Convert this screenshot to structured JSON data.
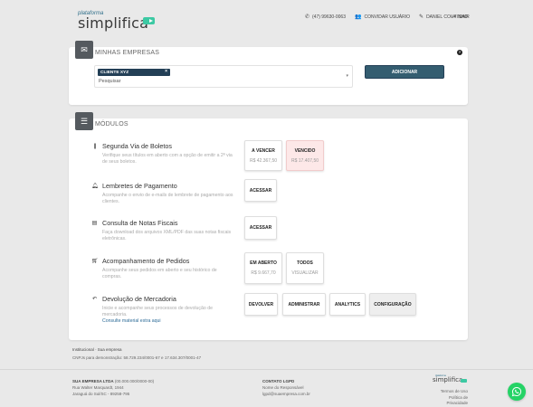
{
  "brand": {
    "small": "plataforma",
    "name": "simplifica"
  },
  "topnav": {
    "phone": "(47) 99630-0063",
    "invite": "CONVIDAR USUÁRIO",
    "user": "DANIEL COUTINHO",
    "exit": "SAIR"
  },
  "empresas": {
    "title": "MINHAS EMPRESAS",
    "tag": "CLIENTE XYZ",
    "search_placeholder": "Pesquisar",
    "add_label": "ADICIONAR"
  },
  "modulos": {
    "title": "MÓDULOS",
    "items": [
      {
        "icon": "barcode-icon",
        "title": "Segunda Via de Boletos",
        "desc": "Verifique seus títulos em aberto com a opção de emitir a 2ª via de seus boletos.",
        "tiles": [
          {
            "label": "A VENCER",
            "sub": "R$ 42.367,50"
          },
          {
            "label": "VENCIDO",
            "sub": "R$ 17.407,50"
          }
        ]
      },
      {
        "icon": "bell-icon",
        "title": "Lembretes de Pagamento",
        "desc": "Acompanhe o envio de e-mails de lembrete de pagamento aos clientes.",
        "tiles": [
          {
            "label": "ACESSAR"
          }
        ]
      },
      {
        "icon": "document-icon",
        "title": "Consulta de Notas Fiscais",
        "desc": "Faça download dos arquivos XML/PDF das suas notas fiscais eletrônicas.",
        "tiles": [
          {
            "label": "ACESSAR"
          }
        ]
      },
      {
        "icon": "cart-icon",
        "title": "Acompanhamento de Pedidos",
        "desc": "Acompanhe seus pedidos em aberto e seu histórico de compras.",
        "tiles": [
          {
            "label": "EM ABERTO",
            "sub": "R$ 9.667,70"
          },
          {
            "label": "TODOS",
            "sub": "VISUALIZAR"
          }
        ]
      },
      {
        "icon": "return-icon",
        "title": "Devolução de Mercadoria",
        "desc": "Inicie e acompanhe seus processos de devolução de mercadoria.",
        "link": "Consulte material extra aqui",
        "tiles": [
          {
            "label": "DEVOLVER"
          },
          {
            "label": "ADMINISTRAR"
          },
          {
            "label": "ANALYTICS"
          },
          {
            "label": "CONFIGURAÇÃO"
          }
        ]
      }
    ]
  },
  "footer": {
    "inst_a": "Institucional",
    "inst_sep": " - ",
    "inst_b": "Sua empresa",
    "cnpj": "CNPJs para demonstração: 58.729.234/0001-67 e 17.634.307/0001-47",
    "company": "SUA EMPRESA LTDA",
    "company_cnpj": " (00.000.000/0000-00)",
    "street": "Rua Walter Marquardt, 1944",
    "city": "Jaraguá do Sul/SC - 89258-795",
    "contact_title": "CONTATO LGPD",
    "contact_name": "Nome do Responsável",
    "contact_email": "lgpd@suaempresa.com.br",
    "terms": "Termos de Uso",
    "privacy": "Política de Privacidade"
  },
  "colors": {
    "accent": "#3cc9a3",
    "primary_button": "#345d70",
    "tag": "#233f56",
    "overdue_bg": "#fde8e8",
    "whatsapp": "#25d366"
  }
}
